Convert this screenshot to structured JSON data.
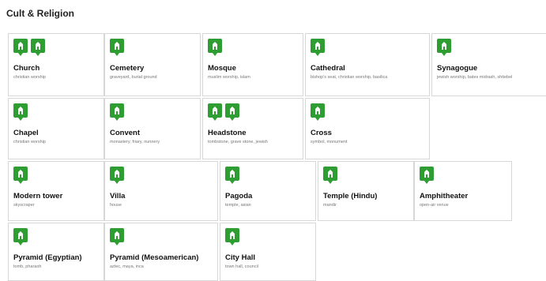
{
  "section": {
    "title": "Cult & Religion"
  },
  "accent_color": "#2e9e32",
  "items": [
    {
      "name": "Church",
      "desc": "christian worship",
      "icons": [
        "church-icon",
        "church-alt-icon"
      ]
    },
    {
      "name": "Cemetery",
      "desc": "graveyard, burial ground",
      "icons": [
        "cemetery-icon"
      ]
    },
    {
      "name": "Mosque",
      "desc": "muslim worship, islam",
      "icons": [
        "mosque-icon"
      ]
    },
    {
      "name": "Cathedral",
      "desc": "bishop's seat, christian worship, basilica",
      "icons": [
        "cathedral-icon"
      ]
    },
    {
      "name": "Synagogue",
      "desc": "jewish worship, bates midrash, shtiebel",
      "icons": [
        "synagogue-icon"
      ]
    },
    {
      "name": "Chapel",
      "desc": "christian worship",
      "icons": [
        "chapel-icon"
      ]
    },
    {
      "name": "Convent",
      "desc": "monastery, friary, nunnery",
      "icons": [
        "convent-icon"
      ]
    },
    {
      "name": "Headstone",
      "desc": "tombstone, grave stone, jewish",
      "icons": [
        "headstone-icon",
        "headstone-jewish-icon"
      ]
    },
    {
      "name": "Cross",
      "desc": "symbol, monument",
      "icons": [
        "cross-icon"
      ]
    },
    {
      "name": "Modern tower",
      "desc": "skyscraper",
      "icons": [
        "modern-tower-icon"
      ]
    },
    {
      "name": "Villa",
      "desc": "house",
      "icons": [
        "villa-icon"
      ]
    },
    {
      "name": "Pagoda",
      "desc": "temple, asian",
      "icons": [
        "pagoda-icon"
      ]
    },
    {
      "name": "Temple (Hindu)",
      "desc": "mandir",
      "icons": [
        "hindu-temple-icon"
      ]
    },
    {
      "name": "Amphitheater",
      "desc": "open-air venue",
      "icons": [
        "amphitheater-icon"
      ]
    },
    {
      "name": "Pyramid (Egyptian)",
      "desc": "tomb, pharaoh",
      "icons": [
        "egyptian-pyramid-icon"
      ]
    },
    {
      "name": "Pyramid (Mesoamerican)",
      "desc": "aztec, maya, inca",
      "icons": [
        "mesoamerican-pyramid-icon"
      ]
    },
    {
      "name": "City Hall",
      "desc": "town hall, council",
      "icons": [
        "city-hall-icon"
      ]
    }
  ]
}
